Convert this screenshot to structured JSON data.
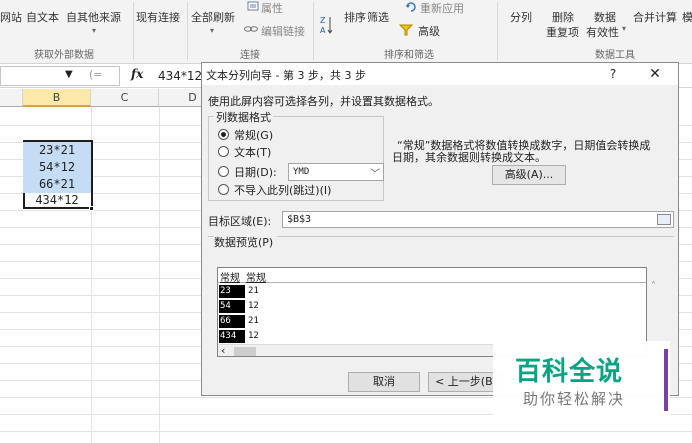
{
  "ribbon": {
    "items": [
      {
        "label": "网站"
      },
      {
        "label": "自文本"
      },
      {
        "label": "自其他来源"
      },
      {
        "label": "现有连接"
      },
      {
        "label": "全部刷新"
      },
      {
        "label": "属性"
      },
      {
        "label": "编辑链接"
      },
      {
        "label": "排序"
      },
      {
        "label": "筛选"
      },
      {
        "label": "重新应用"
      },
      {
        "label": "高级"
      },
      {
        "label": "分列"
      },
      {
        "label": "删除"
      },
      {
        "label": "重复项"
      },
      {
        "label": "数据"
      },
      {
        "label": "有效性"
      },
      {
        "label": "合并计算"
      },
      {
        "label": "模"
      }
    ],
    "groups": {
      "external": "获取外部数据",
      "connections": "连接",
      "sort_filter": "排序和筛选",
      "data_tools": "数据工具"
    }
  },
  "formula_bar": {
    "fx": "fx",
    "value": "434*12"
  },
  "grid": {
    "columns": [
      "B",
      "C",
      "D"
    ],
    "cells": [
      "23*21",
      "54*12",
      "66*21",
      "434*12"
    ]
  },
  "dialog": {
    "title": "文本分列向导 - 第 3 步，共 3 步",
    "help": "?",
    "close": "✕",
    "intro": "使用此屏内容可选择各列，并设置其数据格式。",
    "format_group": "列数据格式",
    "radio_general": "常规(G)",
    "radio_text": "文本(T)",
    "radio_date": "日期(D):",
    "date_value": "YMD",
    "radio_skip": "不导入此列(跳过)(I)",
    "description_1": "“常规”数据格式将数值转换成数字，日期值会转换成",
    "description_2": "日期，其余数据则转换成文本。",
    "advanced": "高级(A)...",
    "destination_label": "目标区域(E):",
    "destination_value": "$B$3",
    "preview_label": "数据预览(P)",
    "preview_headers": [
      "常规",
      "常规"
    ],
    "preview_rows": [
      [
        "23",
        "21"
      ],
      [
        "54",
        "12"
      ],
      [
        "66",
        "21"
      ],
      [
        "434",
        "12"
      ]
    ],
    "cancel": "取消",
    "back": "< 上一步(B)"
  },
  "watermark": {
    "main": "百科全说",
    "sub": "助你轻松解决"
  }
}
